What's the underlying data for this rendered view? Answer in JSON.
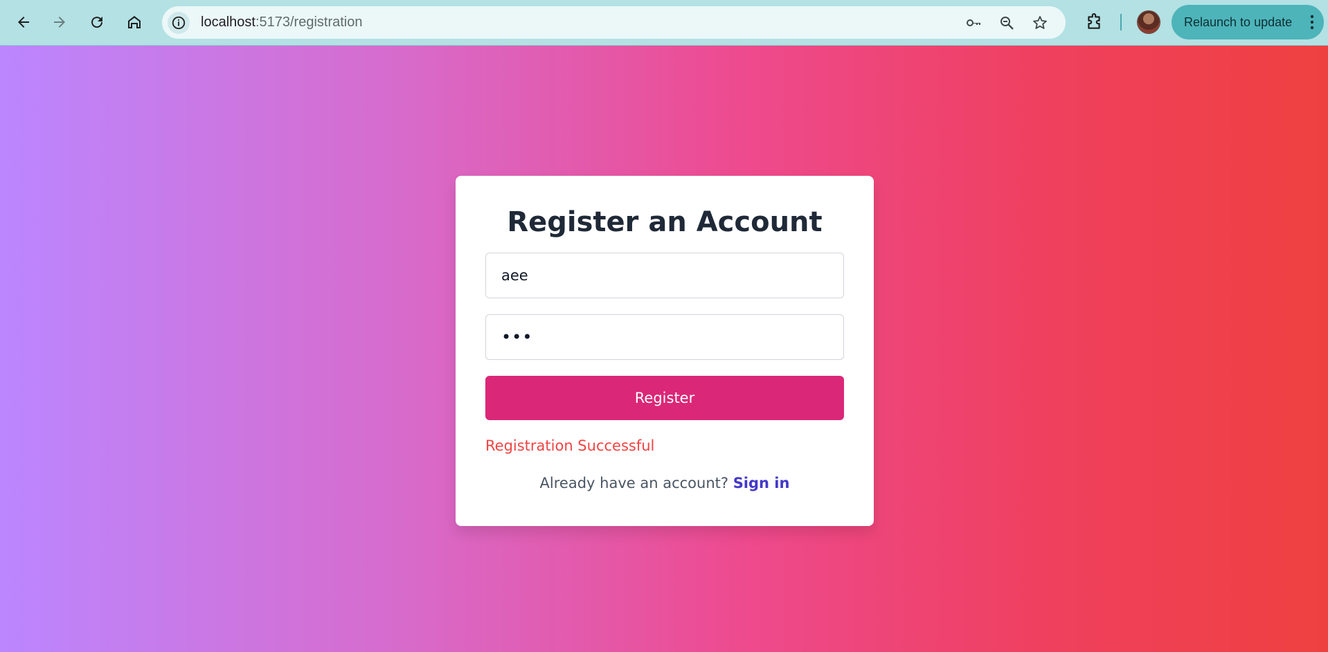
{
  "browser": {
    "url_host": "localhost",
    "url_path": ":5173/registration",
    "relaunch_label": "Relaunch to update",
    "icons": [
      "back-icon",
      "forward-icon",
      "reload-icon",
      "home-icon",
      "site-info-icon",
      "password-key-icon",
      "zoom-icon",
      "bookmark-star-icon",
      "extensions-icon",
      "avatar",
      "more-vert-icon"
    ],
    "toolbar_color": "#b3e1e4",
    "relaunch_color": "#4db4ba"
  },
  "form": {
    "title": "Register an Account",
    "username_value": "aee",
    "password_value": "•••",
    "register_label": "Register",
    "status_message": "Registration Successful",
    "footer_text": "Already have an account? ",
    "signin_label": "Sign in"
  },
  "colors": {
    "button": "#db2777",
    "status": "#ef4444",
    "link": "#4338ca",
    "gradient_start": "#bb86ff",
    "gradient_end": "#ef4040"
  }
}
